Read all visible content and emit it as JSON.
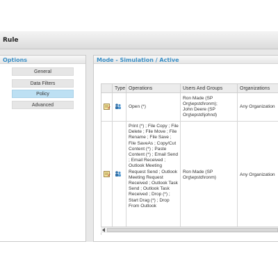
{
  "window": {
    "title": "Rule"
  },
  "options": {
    "header": "Options",
    "items": [
      {
        "label": "General",
        "active": false
      },
      {
        "label": "Data Filters",
        "active": false
      },
      {
        "label": "Policy",
        "active": true
      },
      {
        "label": "Advanced",
        "active": false
      }
    ]
  },
  "mode": {
    "header": "Mode - Simulation / Active",
    "columns": [
      "Type",
      "Operations",
      "Users And Groups",
      "Organizations"
    ],
    "rows": [
      {
        "operations": "Open (*)",
        "users": "Ron Made (SP Org\\epstd\\ronm);\nJohn Deere (SP Org\\epstd\\johnd)",
        "organizations": "Any Organization",
        "icons": [
          "rule-edit-icon",
          "user-group-icon"
        ]
      },
      {
        "operations": "Print (*) ; File Copy ; File Delete ; File Move ; File Rename ; File Save ; File SaveAs ; Copy/Cut Content (*) ; Paste Content (*) ; Email Send ; Email Received ; Outlook Meeting Request Send ; Outlook Meeting Request Received ; Outlook Task Send ; Outlook Task Received ; Drop (*) ; Start Drag (*) ; Drop From Outlook",
        "users": "Ron Made (SP Org\\epstd\\ronm)",
        "organizations": "Any Organization",
        "icons": [
          "rule-edit-icon",
          "user-group-icon"
        ]
      }
    ]
  },
  "colors": {
    "accent": "#3a8fc6",
    "active_option": "#bde0f3"
  }
}
